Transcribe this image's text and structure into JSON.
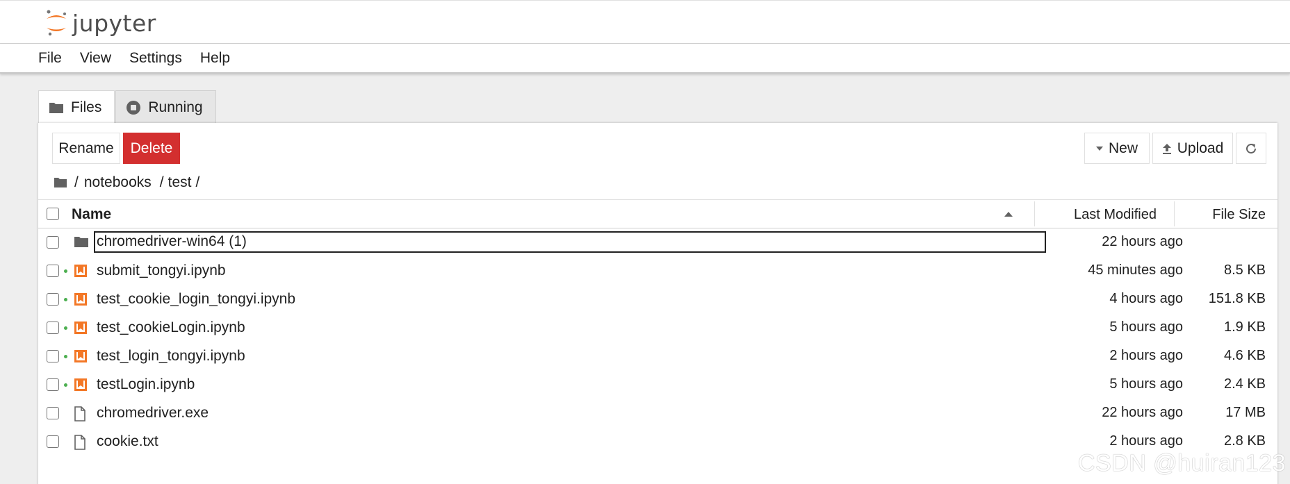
{
  "app": {
    "logo_text": "jupyter"
  },
  "menu": [
    "File",
    "View",
    "Settings",
    "Help"
  ],
  "tabs": [
    {
      "label": "Files",
      "icon": "folder-icon",
      "active": true
    },
    {
      "label": "Running",
      "icon": "stop-circle-icon",
      "active": false
    }
  ],
  "toolbar": {
    "rename_label": "Rename",
    "delete_label": "Delete",
    "new_label": "New",
    "upload_label": "Upload",
    "refresh_icon": "refresh-icon",
    "delete_color": "#d32f2f"
  },
  "breadcrumb": {
    "root": "/",
    "parts": [
      "notebooks",
      "test"
    ],
    "sep": "/"
  },
  "table": {
    "headers": {
      "name": "Name",
      "modified": "Last Modified",
      "size": "File Size"
    },
    "sort": "ascending",
    "rows": [
      {
        "name": "chromedriver-win64 (1)",
        "type": "folder",
        "running": false,
        "modified": "22 hours ago",
        "size": "",
        "selected": true
      },
      {
        "name": "submit_tongyi.ipynb",
        "type": "notebook",
        "running": true,
        "modified": "45 minutes ago",
        "size": "8.5 KB",
        "selected": false
      },
      {
        "name": "test_cookie_login_tongyi.ipynb",
        "type": "notebook",
        "running": true,
        "modified": "4 hours ago",
        "size": "151.8 KB",
        "selected": false
      },
      {
        "name": "test_cookieLogin.ipynb",
        "type": "notebook",
        "running": true,
        "modified": "5 hours ago",
        "size": "1.9 KB",
        "selected": false
      },
      {
        "name": "test_login_tongyi.ipynb",
        "type": "notebook",
        "running": true,
        "modified": "2 hours ago",
        "size": "4.6 KB",
        "selected": false
      },
      {
        "name": "testLogin.ipynb",
        "type": "notebook",
        "running": true,
        "modified": "5 hours ago",
        "size": "2.4 KB",
        "selected": false
      },
      {
        "name": "chromedriver.exe",
        "type": "file",
        "running": false,
        "modified": "22 hours ago",
        "size": "17 MB",
        "selected": false
      },
      {
        "name": "cookie.txt",
        "type": "file",
        "running": false,
        "modified": "2 hours ago",
        "size": "2.8 KB",
        "selected": false
      }
    ]
  },
  "colors": {
    "accent_orange": "#f37726",
    "running_dot": "#4caf50"
  },
  "watermark": "CSDN @huiran123"
}
